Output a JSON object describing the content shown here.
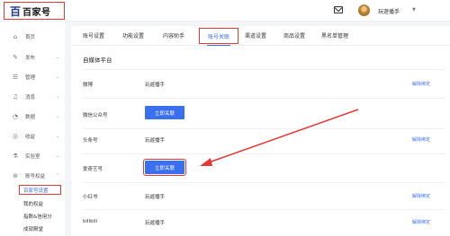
{
  "header": {
    "logo_mark": "百",
    "logo_text": "百家号",
    "username": "玩遊播手",
    "caret": "▼"
  },
  "sidebar": {
    "items": [
      {
        "label": "首页",
        "icon": "home-icon",
        "glyph": "⌂",
        "chevron": ""
      },
      {
        "label": "发布",
        "icon": "publish-icon",
        "glyph": "✎",
        "chevron": "⌄"
      },
      {
        "label": "管理",
        "icon": "manage-icon",
        "glyph": "☰",
        "chevron": "⌄"
      },
      {
        "label": "消息",
        "icon": "bell-icon",
        "glyph": "♫",
        "chevron": "⌄"
      },
      {
        "label": "数据",
        "icon": "data-icon",
        "glyph": "◔",
        "chevron": "⌄"
      },
      {
        "label": "收益",
        "icon": "revenue-icon",
        "glyph": "◎",
        "chevron": "⌄"
      },
      {
        "label": "实验室",
        "icon": "lab-icon",
        "glyph": "⚗",
        "chevron": "⌄"
      },
      {
        "label": "账号权益",
        "icon": "account-icon",
        "glyph": "⊛",
        "chevron": "⌃"
      }
    ],
    "subitems": [
      "百家号设置",
      "我的权益",
      "指数&信用分",
      "成就殿堂"
    ]
  },
  "tabs": [
    "账号设置",
    "功能设置",
    "内容助手",
    "账号关联",
    "渠道设置",
    "商品设置",
    "黑名单管理"
  ],
  "section_title": "自媒体平台",
  "rows": [
    {
      "label": "微博",
      "value": "玩遊播手",
      "action": "解除绑定"
    },
    {
      "label": "微信公众号",
      "button": "立即关联"
    },
    {
      "label": "头条号",
      "value": "玩遊播手",
      "action": "解除绑定"
    },
    {
      "label": "爱奇艺号",
      "button": "立即关联"
    },
    {
      "label": "小红书",
      "value": "玩遊播手",
      "action": "解除绑定"
    },
    {
      "label": "bilibili",
      "value": "玩遊播手",
      "action": "解除绑定"
    }
  ],
  "colors": {
    "accent": "#3a6ff0",
    "highlight": "#e53935"
  }
}
